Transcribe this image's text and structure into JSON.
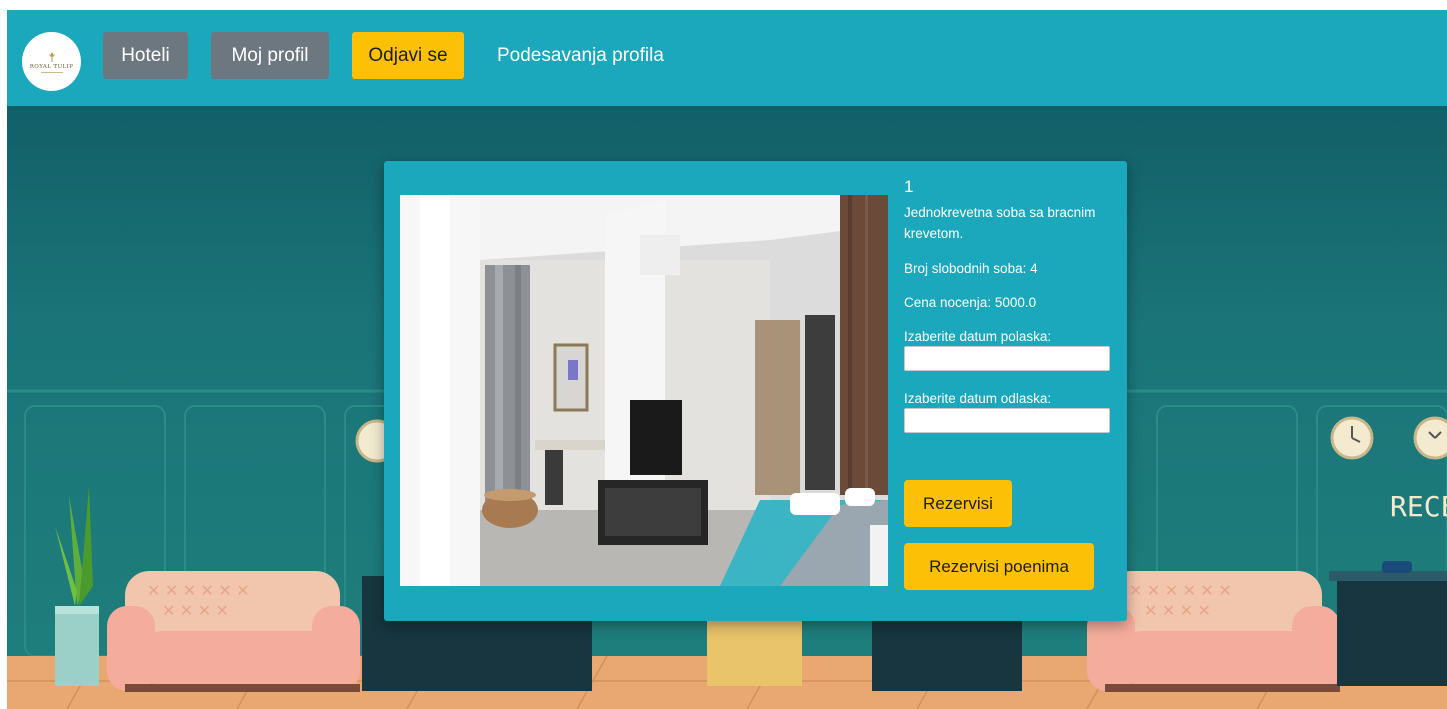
{
  "logo": {
    "text": "ROYAL TULIP"
  },
  "nav": {
    "hotels_label": "Hoteli",
    "profile_label": "Moj profil",
    "logout_label": "Odjavi se",
    "settings_label": "Podesavanja profila"
  },
  "background": {
    "sign_text": "RECEI"
  },
  "room": {
    "number": "1",
    "description": "Jednokrevetna soba sa bracnim krevetom.",
    "free_rooms": "Broj slobodnih soba: 4",
    "price": "Cena nocenja: 5000.0",
    "departure_label": "Izaberite datum polaska:",
    "departure_value": "",
    "arrival_label": "Izaberite datum odlaska:",
    "arrival_value": "",
    "book_label": "Rezervisi",
    "book_points_label": "Rezervisi poenima"
  },
  "colors": {
    "navbar": "#1ba7bc",
    "card": "#1ba7bc",
    "gray_button": "#6d7780",
    "yellow_button": "#fcc107",
    "wall": "#1c7779",
    "floor": "#e9a872"
  }
}
